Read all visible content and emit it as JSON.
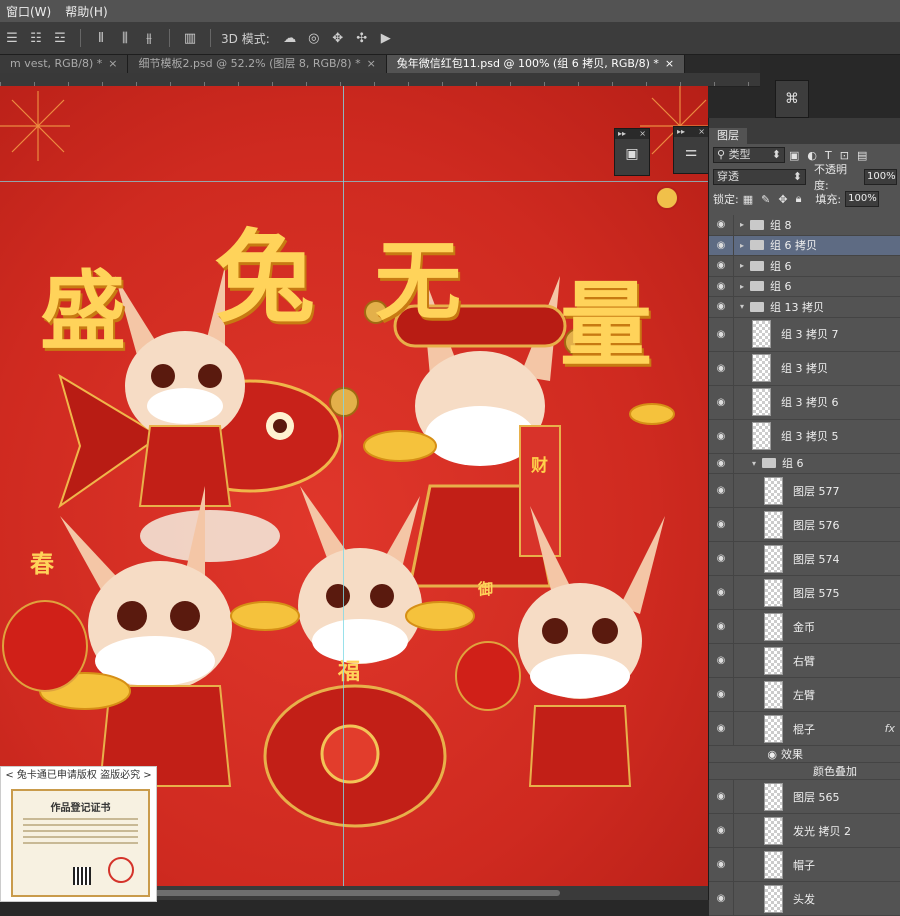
{
  "menu": {
    "items": [
      "窗口(W)",
      "帮助(H)"
    ]
  },
  "options_bar": {
    "mode_3d_label": "3D 模式:"
  },
  "tabs": [
    {
      "label": "m vest, RGB/8) *",
      "active": false,
      "close": "×"
    },
    {
      "label": "细节模板2.psd @ 52.2% (图层 8, RGB/8) *",
      "active": false,
      "close": "×"
    },
    {
      "label": "兔年微信红包11.psd @ 100% (组 6 拷贝, RGB/8) *",
      "active": true,
      "close": "×"
    }
  ],
  "canvas": {
    "title_chars": [
      "盛",
      "兔",
      "无",
      "量"
    ],
    "scroll_chars": [
      "财",
      "福",
      "春",
      "御"
    ]
  },
  "layers_panel": {
    "tab_label": "图层",
    "filter_label": "类型",
    "blend_mode": "穿透",
    "opacity_label": "不透明度:",
    "opacity_value": "100%",
    "lock_label": "锁定:",
    "fill_label": "填充:",
    "fill_value": "100%",
    "layers": [
      {
        "name": "组 8",
        "kind": "group",
        "indent": 0,
        "expanded": false,
        "selected": false
      },
      {
        "name": "组 6 拷贝",
        "kind": "group",
        "indent": 0,
        "expanded": false,
        "selected": true
      },
      {
        "name": "组 6",
        "kind": "group",
        "indent": 0,
        "expanded": false,
        "selected": false
      },
      {
        "name": "组 6",
        "kind": "group",
        "indent": 0,
        "expanded": false,
        "selected": false
      },
      {
        "name": "组 13 拷贝",
        "kind": "group",
        "indent": 0,
        "expanded": true,
        "selected": false
      },
      {
        "name": "组 3 拷贝 7",
        "kind": "layer",
        "indent": 1,
        "selected": false
      },
      {
        "name": "组 3 拷贝",
        "kind": "layer",
        "indent": 1,
        "selected": false
      },
      {
        "name": "组 3 拷贝 6",
        "kind": "layer",
        "indent": 1,
        "selected": false
      },
      {
        "name": "组 3 拷贝 5",
        "kind": "layer",
        "indent": 1,
        "selected": false
      },
      {
        "name": "组 6",
        "kind": "group",
        "indent": 1,
        "expanded": true,
        "selected": false
      },
      {
        "name": "图层 577",
        "kind": "layer",
        "indent": 2,
        "selected": false
      },
      {
        "name": "图层 576",
        "kind": "layer",
        "indent": 2,
        "selected": false
      },
      {
        "name": "图层 574",
        "kind": "layer",
        "indent": 2,
        "selected": false
      },
      {
        "name": "图层 575",
        "kind": "layer",
        "indent": 2,
        "selected": false
      },
      {
        "name": "金币",
        "kind": "layer",
        "indent": 2,
        "selected": false
      },
      {
        "name": "右臂",
        "kind": "layer",
        "indent": 2,
        "selected": false
      },
      {
        "name": "左臂",
        "kind": "layer",
        "indent": 2,
        "selected": false
      },
      {
        "name": "棍子",
        "kind": "layer",
        "indent": 2,
        "selected": false,
        "fx": "fx"
      },
      {
        "name": "效果",
        "kind": "effect",
        "indent": 3
      },
      {
        "name": "颜色叠加",
        "kind": "effect-item",
        "indent": 4
      },
      {
        "name": "图层 565",
        "kind": "layer",
        "indent": 2,
        "selected": false
      },
      {
        "name": "发光 拷贝 2",
        "kind": "layer",
        "indent": 2,
        "selected": false
      },
      {
        "name": "帽子",
        "kind": "layer",
        "indent": 2,
        "selected": false
      },
      {
        "name": "头发",
        "kind": "layer",
        "indent": 2,
        "selected": false
      }
    ]
  },
  "watermark": {
    "banner": "< 兔卡通已申请版权 盗版必究 >",
    "certificate_title": "作品登记证书"
  },
  "colors": {
    "canvas_red": "#d4301f",
    "title_gold": "#ffd35a",
    "selected_layer": "#5e6b83",
    "panel_bg": "#535353"
  }
}
